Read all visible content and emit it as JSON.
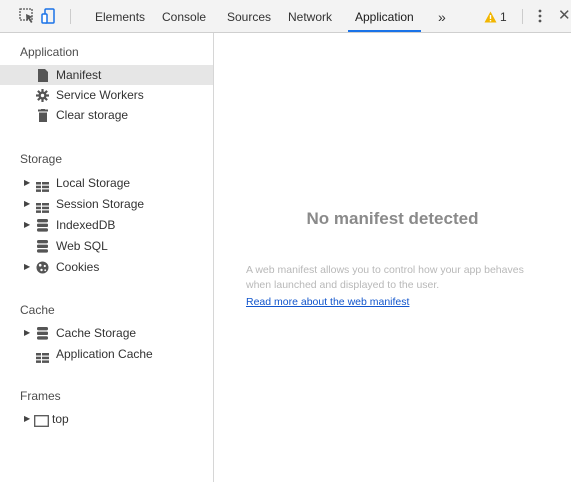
{
  "toolbar": {
    "tabs": [
      "Elements",
      "Console",
      "Sources",
      "Network",
      "Application"
    ],
    "active_tab": "Application",
    "overflow": "»",
    "warning_count": "1",
    "accent_color": "#1a73e8",
    "warning_color": "#f2b600"
  },
  "sidebar": {
    "application": {
      "title": "Application",
      "items": [
        "Manifest",
        "Service Workers",
        "Clear storage"
      ]
    },
    "storage": {
      "title": "Storage",
      "items": [
        "Local Storage",
        "Session Storage",
        "IndexedDB",
        "Web SQL",
        "Cookies"
      ]
    },
    "cache": {
      "title": "Cache",
      "items": [
        "Cache Storage",
        "Application Cache"
      ]
    },
    "frames": {
      "title": "Frames",
      "items": [
        "top"
      ]
    }
  },
  "main": {
    "title": "No manifest detected",
    "description": "A web manifest allows you to control how your app behaves when launched and displayed to the user.",
    "link": "Read more about the web manifest"
  }
}
